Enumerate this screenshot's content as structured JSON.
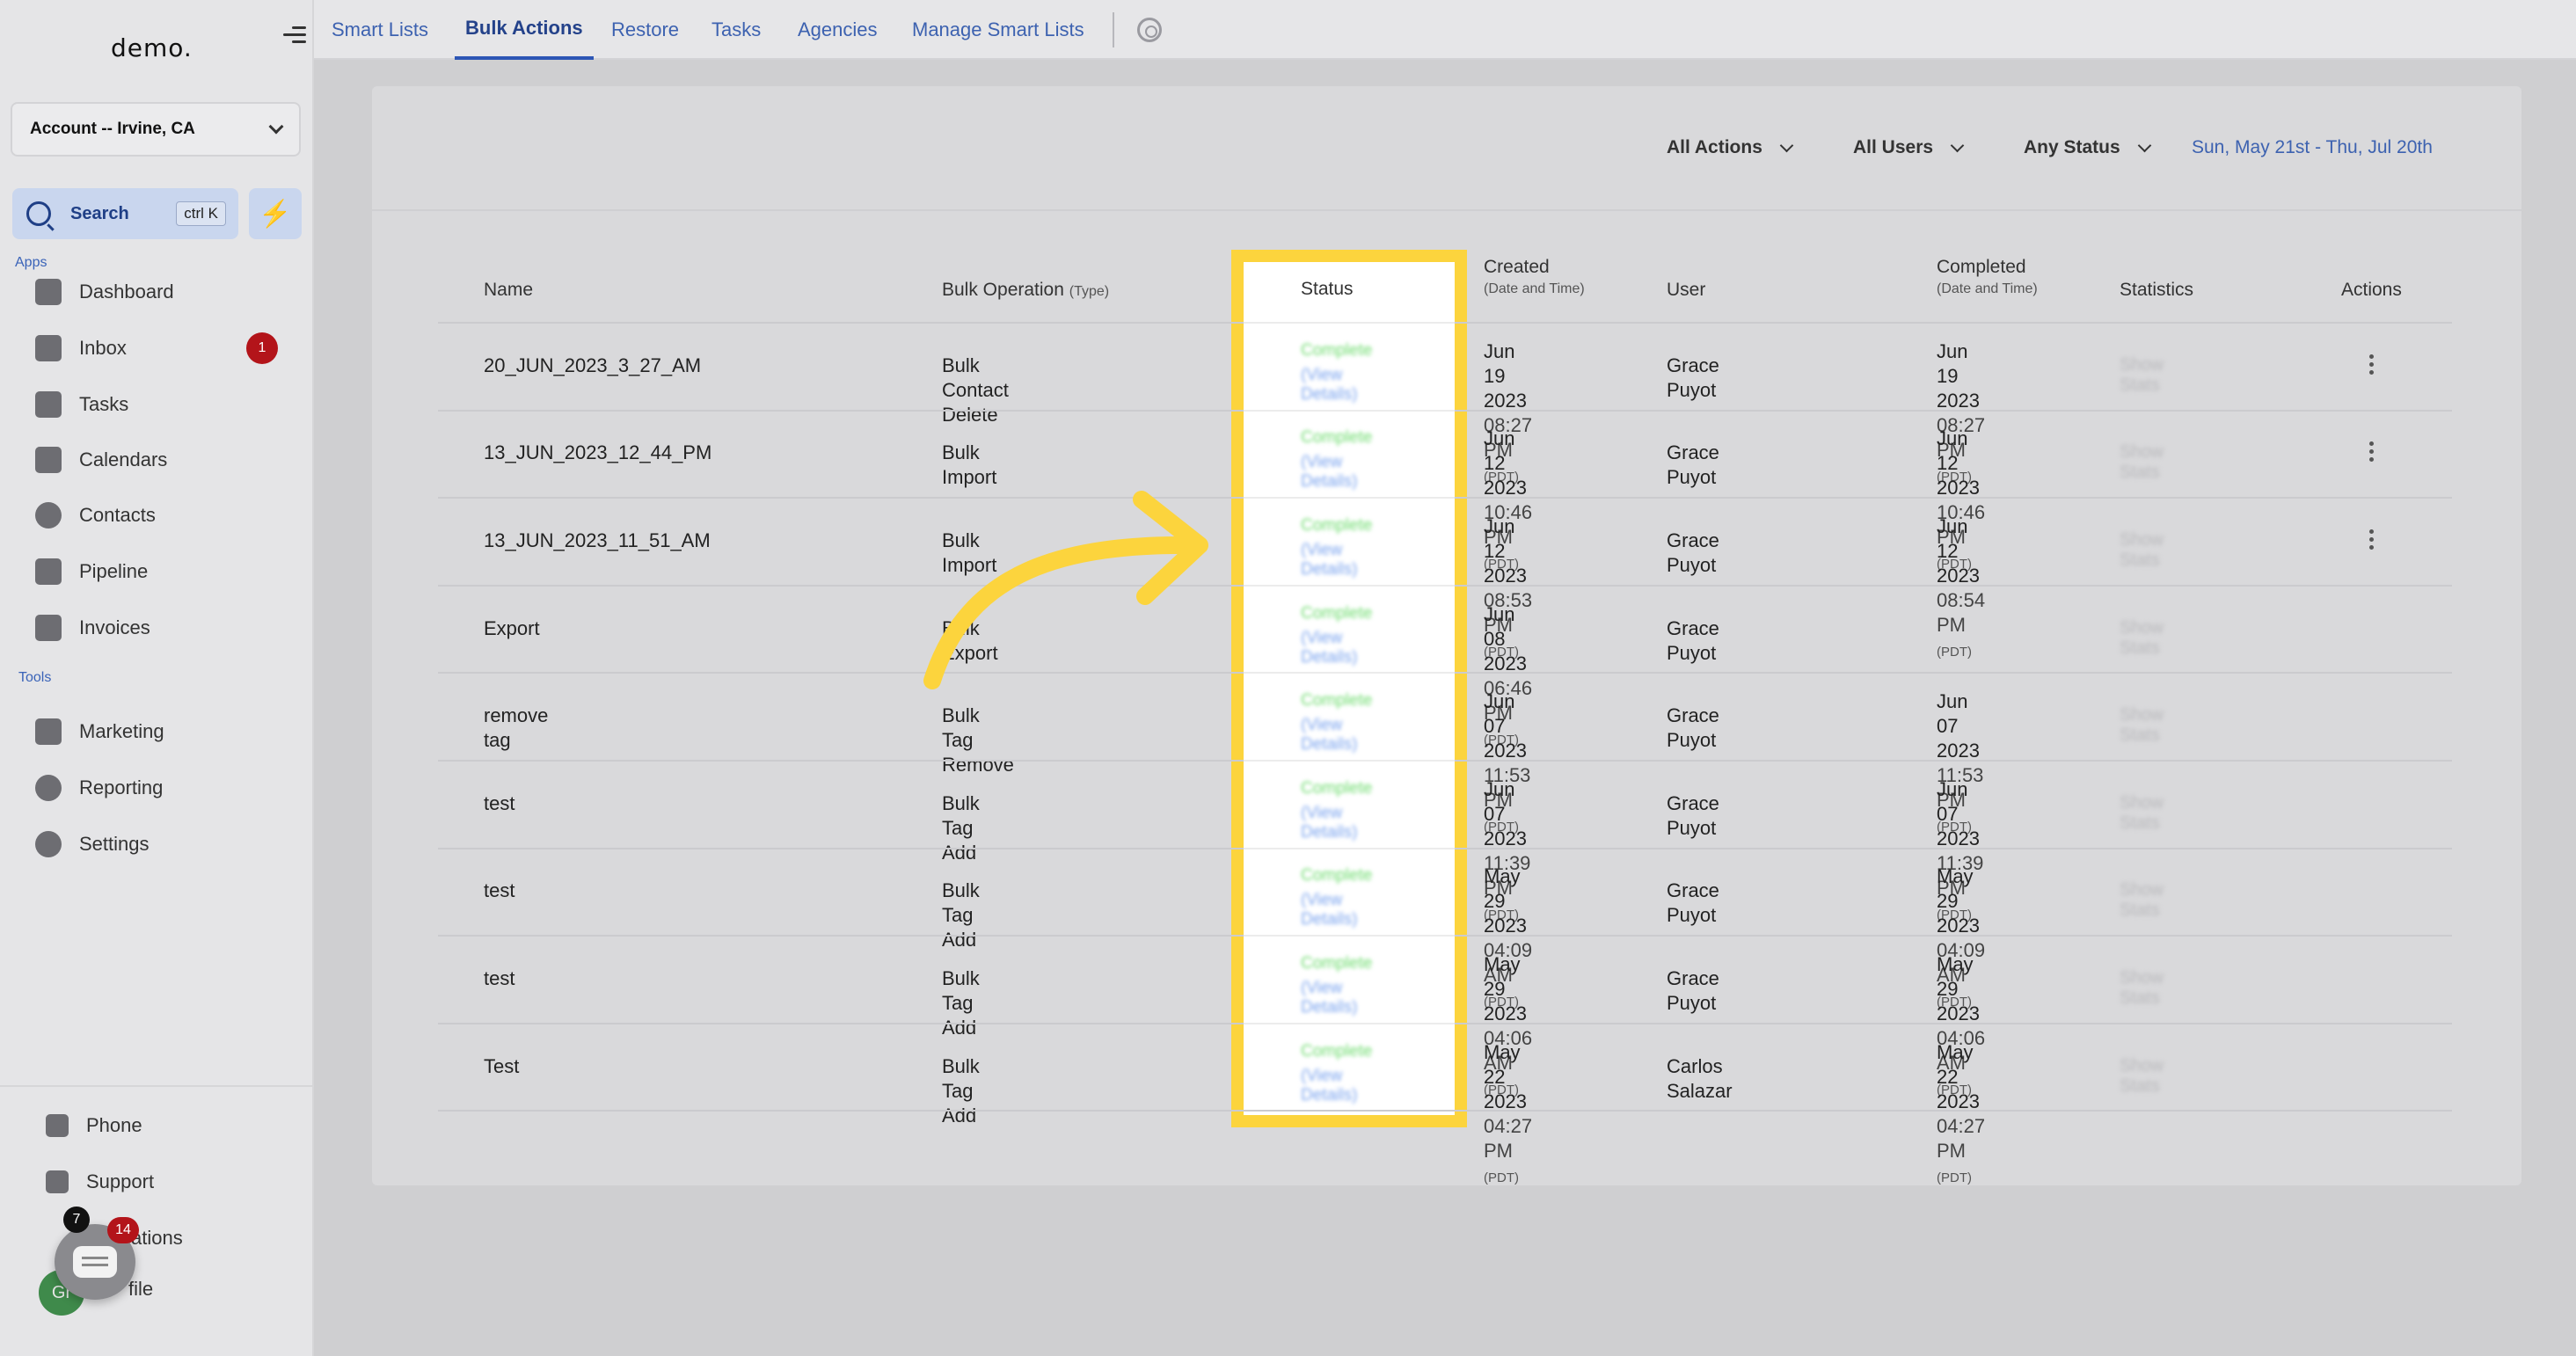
{
  "sidebar": {
    "logo": "demo.",
    "account": "Account -- Irvine, CA",
    "search_label": "Search",
    "search_shortcut": "ctrl K",
    "apps_label": "Apps",
    "tools_label": "Tools",
    "apps": [
      {
        "label": "Dashboard",
        "icon": "dashboard-icon"
      },
      {
        "label": "Inbox",
        "icon": "inbox-icon",
        "badge": "1"
      },
      {
        "label": "Tasks",
        "icon": "tasks-icon"
      },
      {
        "label": "Calendars",
        "icon": "calendar-icon"
      },
      {
        "label": "Contacts",
        "icon": "contacts-icon"
      },
      {
        "label": "Pipeline",
        "icon": "pipeline-icon"
      },
      {
        "label": "Invoices",
        "icon": "invoices-icon"
      }
    ],
    "tools": [
      {
        "label": "Marketing",
        "icon": "megaphone-icon"
      },
      {
        "label": "Reporting",
        "icon": "pie-chart-icon"
      },
      {
        "label": "Settings",
        "icon": "gear-icon"
      }
    ],
    "bottom": [
      {
        "label": "Phone",
        "icon": "phone-icon"
      },
      {
        "label": "Support",
        "icon": "support-icon"
      },
      {
        "label": "cations",
        "icon": "notifications-icon"
      },
      {
        "label": "file",
        "icon": "profile-icon"
      }
    ],
    "chat_badge_dark": "7",
    "chat_badge_red": "14",
    "avatar_initials": "Gr"
  },
  "tabs": [
    {
      "label": "Smart Lists"
    },
    {
      "label": "Bulk Actions",
      "active": true
    },
    {
      "label": "Restore"
    },
    {
      "label": "Tasks"
    },
    {
      "label": "Agencies"
    },
    {
      "label": "Manage Smart Lists"
    }
  ],
  "filters": {
    "actions": "All Actions",
    "users": "All Users",
    "status": "Any Status",
    "date_range": "Sun, May 21st - Thu, Jul 20th"
  },
  "table": {
    "headers": {
      "name": "Name",
      "operation": "Bulk Operation",
      "operation_sub": "(Type)",
      "status": "Status",
      "created": "Created",
      "created_sub": "(Date and Time)",
      "user": "User",
      "completed": "Completed",
      "completed_sub": "(Date and Time)",
      "statistics": "Statistics",
      "actions": "Actions"
    },
    "tz": "(PDT)",
    "status_text": "Complete",
    "status_link": "(View Details)",
    "stats_text": "Show Stats",
    "rows": [
      {
        "name": "20_JUN_2023_3_27_AM",
        "op": "Bulk Contact Delete",
        "c_date": "Jun 19 2023",
        "c_time": "08:27 PM",
        "user": "Grace Puyot",
        "d_date": "Jun 19 2023",
        "d_time": "08:27 PM"
      },
      {
        "name": "13_JUN_2023_12_44_PM",
        "op": "Bulk Import",
        "c_date": "Jun 12 2023",
        "c_time": "10:46 PM",
        "user": "Grace Puyot",
        "d_date": "Jun 12 2023",
        "d_time": "10:46 PM"
      },
      {
        "name": "13_JUN_2023_11_51_AM",
        "op": "Bulk Import",
        "c_date": "Jun 12 2023",
        "c_time": "08:53 PM",
        "user": "Grace Puyot",
        "d_date": "Jun 12 2023",
        "d_time": "08:54 PM"
      },
      {
        "name": "Export",
        "op": "Bulk Export",
        "c_date": "Jun 08 2023",
        "c_time": "06:46 PM",
        "user": "Grace Puyot",
        "d_date": "",
        "d_time": ""
      },
      {
        "name": "remove tag",
        "op": "Bulk Tag Remove",
        "c_date": "Jun 07 2023",
        "c_time": "11:53 PM",
        "user": "Grace Puyot",
        "d_date": "Jun 07 2023",
        "d_time": "11:53 PM"
      },
      {
        "name": "test",
        "op": "Bulk Tag Add",
        "c_date": "Jun 07 2023",
        "c_time": "11:39 PM",
        "user": "Grace Puyot",
        "d_date": "Jun 07 2023",
        "d_time": "11:39 PM"
      },
      {
        "name": "test",
        "op": "Bulk Tag Add",
        "c_date": "May 29 2023",
        "c_time": "04:09 AM",
        "user": "Grace Puyot",
        "d_date": "May 29 2023",
        "d_time": "04:09 AM"
      },
      {
        "name": "test",
        "op": "Bulk Tag Add",
        "c_date": "May 29 2023",
        "c_time": "04:06 AM",
        "user": "Grace Puyot",
        "d_date": "May 29 2023",
        "d_time": "04:06 AM"
      },
      {
        "name": "Test",
        "op": "Bulk Tag Add",
        "c_date": "May 22 2023",
        "c_time": "04:27 PM",
        "user": "Carlos Salazar",
        "d_date": "May 22 2023",
        "d_time": "04:27 PM"
      }
    ]
  },
  "colors": {
    "highlight": "#fcd43d",
    "accent": "#2d56b5",
    "status_green": "#6fdc6f"
  }
}
